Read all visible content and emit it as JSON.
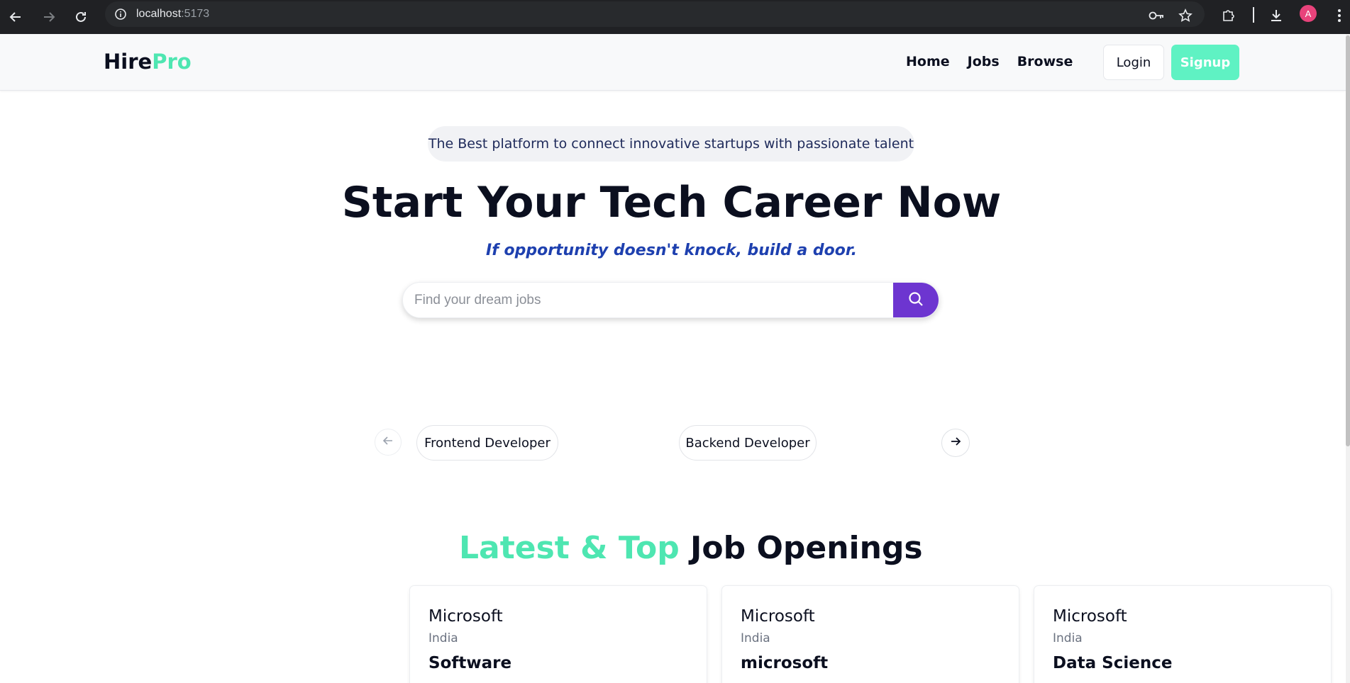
{
  "browser": {
    "url_host": "localhost",
    "url_port": ":5173",
    "avatar_letter": "A"
  },
  "navbar": {
    "logo_main": "Hire",
    "logo_accent": "Pro",
    "links": [
      "Home",
      "Jobs",
      "Browse"
    ],
    "login_label": "Login",
    "signup_label": "Signup"
  },
  "hero": {
    "badge": "The Best platform to connect innovative startups with passionate talent",
    "title": "Start Your Tech Career Now",
    "tagline": "If opportunity doesn't knock, build a door.",
    "search_placeholder": "Find your dream jobs"
  },
  "carousel": {
    "items": [
      "Frontend Developer",
      "Backend Developer"
    ]
  },
  "jobs_section": {
    "title_accent": "Latest & Top",
    "title_rest": " Job Openings",
    "cards": [
      {
        "company": "Microsoft",
        "location": "India",
        "role": "Software"
      },
      {
        "company": "Microsoft",
        "location": "India",
        "role": "microsoft"
      },
      {
        "company": "Microsoft",
        "location": "India",
        "role": "Data Science"
      }
    ]
  },
  "colors": {
    "accent": "#4ee6b1",
    "signup_bg": "#5ff2c3",
    "search_button": "#6d35d0",
    "tagline": "#1e40af"
  },
  "icons": {
    "back": "arrow-left-icon",
    "forward": "arrow-right-icon",
    "reload": "reload-icon",
    "site_info": "info-icon",
    "password": "key-icon",
    "bookmark": "star-icon",
    "extensions": "puzzle-icon",
    "downloads": "download-icon",
    "menu": "kebab-menu-icon",
    "search": "search-icon"
  }
}
